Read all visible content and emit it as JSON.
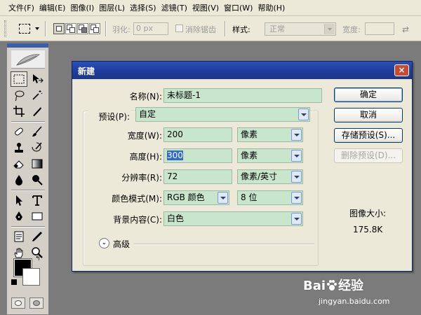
{
  "menubar": {
    "items": [
      "文件(F)",
      "编辑(E)",
      "图像(I)",
      "图层(L)",
      "选择(S)",
      "滤镜(T)",
      "视图(V)",
      "窗口(W)",
      "帮助(H)"
    ]
  },
  "options": {
    "feather_label": "羽化:",
    "feather_value": "0 px",
    "antialias_label": "消除锯齿",
    "style_label": "样式:",
    "style_value": "正常",
    "width_label": "宽度:"
  },
  "icons": {
    "marquee": "rect-marquee-icon",
    "swap": "swap-arrows-icon",
    "logo": "feather-logo-icon"
  },
  "colors": {
    "foreground": "#000000",
    "background": "#ffffff",
    "field_bg": "#c8e6cc",
    "titlebar": "#1f3f9e"
  },
  "dialog": {
    "title": "新建",
    "close_label": "×",
    "name_label": "名称(N):",
    "name_value": "未标题-1",
    "preset_label": "预设(P):",
    "preset_value": "自定",
    "width_label": "宽度(W):",
    "width_value": "200",
    "width_unit": "像素",
    "height_label": "高度(H):",
    "height_value": "300",
    "height_unit": "像素",
    "resolution_label": "分辨率(R):",
    "resolution_value": "72",
    "resolution_unit": "像素/英寸",
    "color_mode_label": "颜色模式(M):",
    "color_mode_value": "RGB 颜色",
    "bit_depth": "8 位",
    "bg_content_label": "背景内容(C):",
    "bg_content_value": "白色",
    "advanced_label": "高级",
    "advanced_icon": "chevron-double-down-icon",
    "buttons": {
      "ok": "确定",
      "cancel": "取消",
      "save_preset": "存储预设(S)...",
      "delete_preset": "删除预设(D)..."
    },
    "image_size_label": "图像大小:",
    "image_size_value": "175.8K"
  },
  "watermark": {
    "brand": "Bai",
    "brand_suffix": "经验",
    "url": "jingyan.baidu.com"
  }
}
